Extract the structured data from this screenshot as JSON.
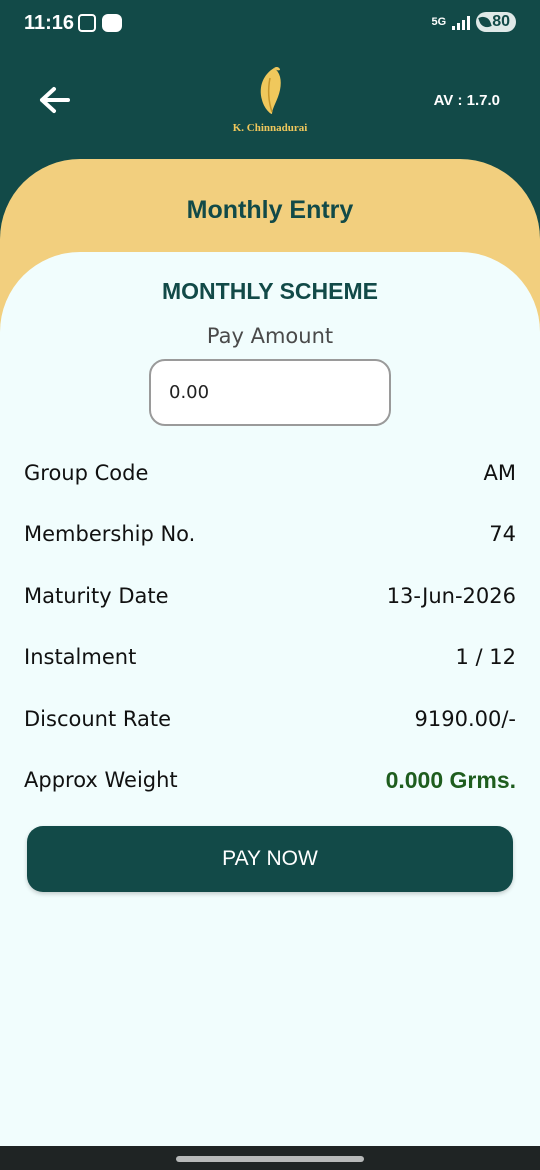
{
  "status_bar": {
    "time": "11:16",
    "network": "5G",
    "battery": "80"
  },
  "app_bar": {
    "logo_text": "K. Chinnadurai",
    "version": "AV : 1.7.0"
  },
  "page": {
    "title": "Monthly Entry",
    "scheme_title": "MONTHLY SCHEME",
    "pay_amount_label": "Pay Amount",
    "pay_amount_value": "0.00"
  },
  "details": [
    {
      "label": "Group Code",
      "value": "AM"
    },
    {
      "label": "Membership No.",
      "value": "74"
    },
    {
      "label": "Maturity Date",
      "value": "13-Jun-2026"
    },
    {
      "label": "Instalment",
      "value": "1 / 12"
    },
    {
      "label": "Discount Rate",
      "value": "9190.00/-"
    },
    {
      "label": "Approx Weight",
      "value": "0.000 Grms."
    }
  ],
  "actions": {
    "pay_now": "PAY NOW"
  },
  "colors": {
    "primary": "#124a48",
    "accent": "#f2cf7e",
    "gold": "#f0c85c",
    "background": "#f1fdfd",
    "weight_green": "#1e5d1e"
  }
}
